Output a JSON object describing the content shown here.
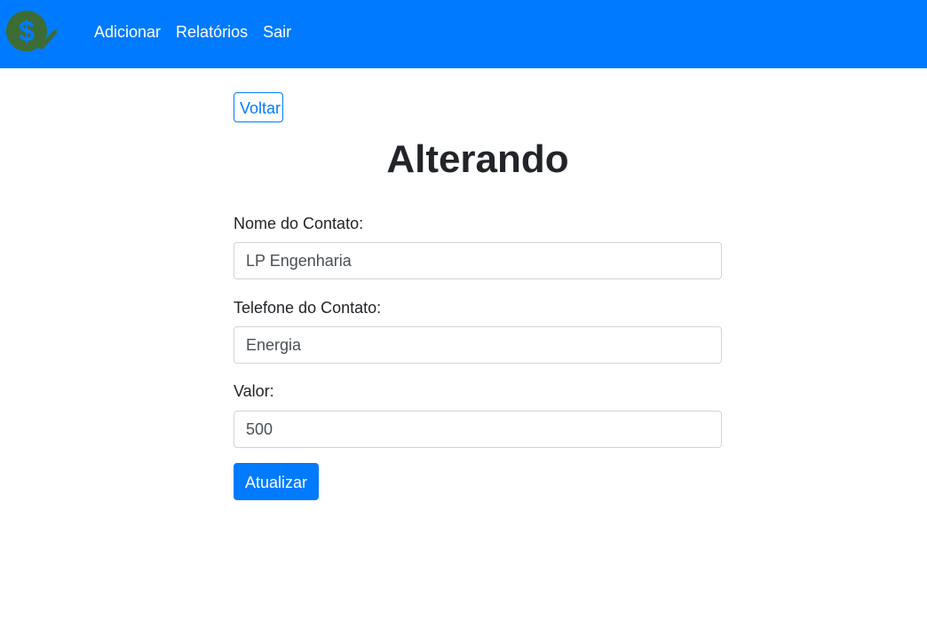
{
  "navbar": {
    "logo_icon": "dollar-coin-check-icon",
    "links": [
      "Adicionar",
      "Relatórios",
      "Sair"
    ]
  },
  "main": {
    "back_label": "Voltar",
    "title": "Alterando",
    "fields": [
      {
        "label": "Nome do Contato:",
        "value": "LP Engenharia"
      },
      {
        "label": "Telefone do Contato:",
        "value": "Energia"
      },
      {
        "label": "Valor:",
        "value": "500"
      }
    ],
    "submit_label": "Atualizar"
  },
  "colors": {
    "primary": "#007bff",
    "logo_green": "#3d6b35"
  }
}
